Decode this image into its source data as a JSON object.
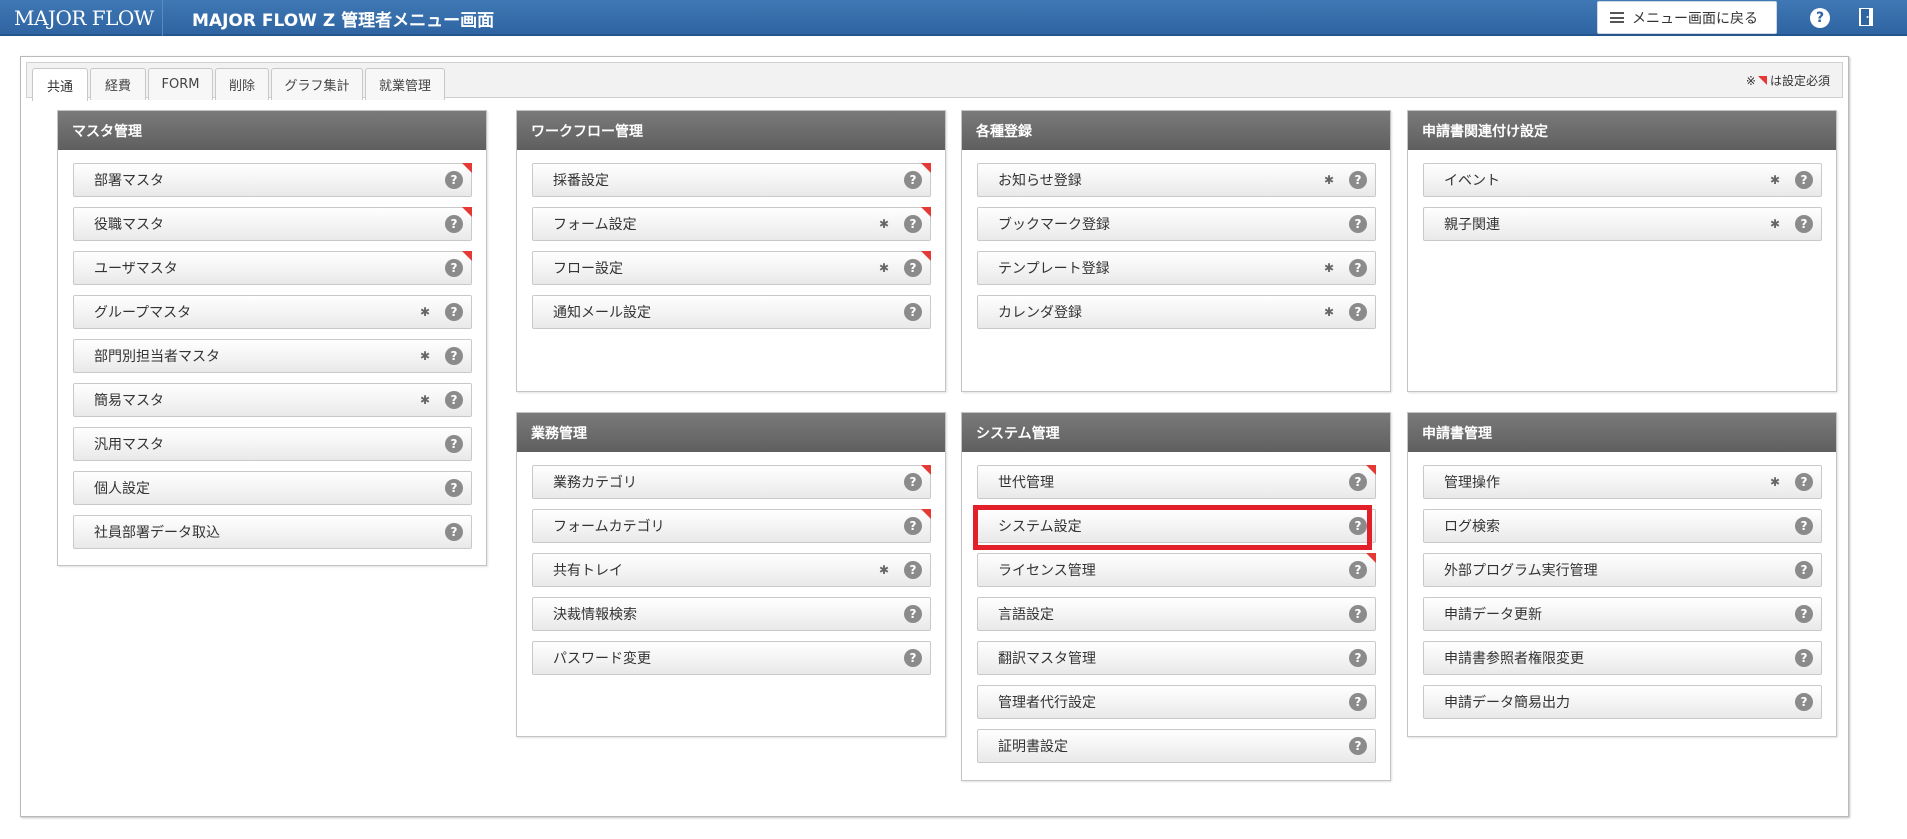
{
  "header": {
    "logo_text": "MAJOR FLOW",
    "title": "MAJOR FLOW Z 管理者メニュー画面",
    "back_button": "メニュー画面に戻る",
    "help_glyph": "?",
    "icons": [
      "menu-icon",
      "help-icon",
      "logout-door-icon"
    ]
  },
  "tabs": [
    "共通",
    "経費",
    "FORM",
    "削除",
    "グラフ集計",
    "就業管理"
  ],
  "active_tab": "共通",
  "required_note": {
    "prefix": "※",
    "suffix": "は設定必須"
  },
  "colors": {
    "header": "#3469a6",
    "panel_head": "#6b6b6b",
    "required_flag": "#e53935",
    "highlight": "#e3202a",
    "help_badge": "#8b8b8b"
  },
  "panels": [
    {
      "title": "マスタ管理",
      "items": [
        {
          "label": "部署マスタ",
          "asterisk": false,
          "required": true
        },
        {
          "label": "役職マスタ",
          "asterisk": false,
          "required": true
        },
        {
          "label": "ユーザマスタ",
          "asterisk": false,
          "required": true
        },
        {
          "label": "グループマスタ",
          "asterisk": true,
          "required": false
        },
        {
          "label": "部門別担当者マスタ",
          "asterisk": true,
          "required": false
        },
        {
          "label": "簡易マスタ",
          "asterisk": true,
          "required": false
        },
        {
          "label": "汎用マスタ",
          "asterisk": false,
          "required": false
        },
        {
          "label": "個人設定",
          "asterisk": false,
          "required": false
        },
        {
          "label": "社員部署データ取込",
          "asterisk": false,
          "required": false
        }
      ]
    },
    {
      "title": "ワークフロー管理",
      "items": [
        {
          "label": "採番設定",
          "asterisk": false,
          "required": true
        },
        {
          "label": "フォーム設定",
          "asterisk": true,
          "required": true
        },
        {
          "label": "フロー設定",
          "asterisk": true,
          "required": true
        },
        {
          "label": "通知メール設定",
          "asterisk": false,
          "required": false
        }
      ]
    },
    {
      "title": "各種登録",
      "items": [
        {
          "label": "お知らせ登録",
          "asterisk": true,
          "required": false
        },
        {
          "label": "ブックマーク登録",
          "asterisk": false,
          "required": false
        },
        {
          "label": "テンプレート登録",
          "asterisk": true,
          "required": false
        },
        {
          "label": "カレンダ登録",
          "asterisk": true,
          "required": false
        }
      ]
    },
    {
      "title": "申請書関連付け設定",
      "items": [
        {
          "label": "イベント",
          "asterisk": true,
          "required": false
        },
        {
          "label": "親子関連",
          "asterisk": true,
          "required": false
        }
      ]
    },
    {
      "title": "業務管理",
      "items": [
        {
          "label": "業務カテゴリ",
          "asterisk": false,
          "required": true
        },
        {
          "label": "フォームカテゴリ",
          "asterisk": false,
          "required": true
        },
        {
          "label": "共有トレイ",
          "asterisk": true,
          "required": false
        },
        {
          "label": "決裁情報検索",
          "asterisk": false,
          "required": false
        },
        {
          "label": "パスワード変更",
          "asterisk": false,
          "required": false
        }
      ]
    },
    {
      "title": "システム管理",
      "items": [
        {
          "label": "世代管理",
          "asterisk": false,
          "required": true
        },
        {
          "label": "システム設定",
          "asterisk": false,
          "required": false,
          "highlighted": true
        },
        {
          "label": "ライセンス管理",
          "asterisk": false,
          "required": true
        },
        {
          "label": "言語設定",
          "asterisk": false,
          "required": false
        },
        {
          "label": "翻訳マスタ管理",
          "asterisk": false,
          "required": false
        },
        {
          "label": "管理者代行設定",
          "asterisk": false,
          "required": false
        },
        {
          "label": "証明書設定",
          "asterisk": false,
          "required": false
        }
      ]
    },
    {
      "title": "申請書管理",
      "items": [
        {
          "label": "管理操作",
          "asterisk": true,
          "required": false
        },
        {
          "label": "ログ検索",
          "asterisk": false,
          "required": false
        },
        {
          "label": "外部プログラム実行管理",
          "asterisk": false,
          "required": false
        },
        {
          "label": "申請データ更新",
          "asterisk": false,
          "required": false
        },
        {
          "label": "申請書参照者権限変更",
          "asterisk": false,
          "required": false
        },
        {
          "label": "申請データ簡易出力",
          "asterisk": false,
          "required": false
        }
      ]
    }
  ]
}
